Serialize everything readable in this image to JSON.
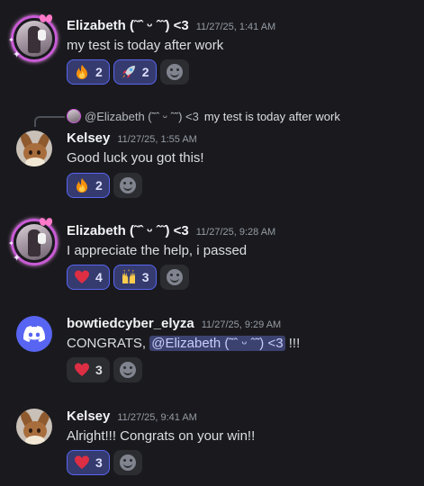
{
  "messages": [
    {
      "author": "Elizabeth (˜ˆ ᵕ ˆ˜) <3",
      "timestamp": "11/27/25, 1:41 AM",
      "text": "my test is today after work",
      "avatar": "decorated-profile-photo",
      "reactions": [
        {
          "emoji": "fire",
          "count": "2",
          "me": true
        },
        {
          "emoji": "rocket",
          "count": "2",
          "me": true
        }
      ]
    },
    {
      "reply_to": {
        "author": "@Elizabeth (˜ˆ ᵕ ˆ˜) <3",
        "text": "my test is today after work"
      },
      "author": "Kelsey",
      "timestamp": "11/27/25, 1:55 AM",
      "text": "Good luck you got this!",
      "avatar": "eevee",
      "reactions": [
        {
          "emoji": "fire",
          "count": "2",
          "me": true
        }
      ]
    },
    {
      "author": "Elizabeth (˜ˆ ᵕ ˆ˜) <3",
      "timestamp": "11/27/25, 9:28 AM",
      "text": "I appreciate the help, i passed",
      "avatar": "decorated-profile-photo",
      "reactions": [
        {
          "emoji": "red-heart",
          "count": "4",
          "me": true
        },
        {
          "emoji": "raising-hands",
          "count": "3",
          "me": true
        }
      ]
    },
    {
      "author": "bowtiedcyber_elyza",
      "timestamp": "11/27/25, 9:29 AM",
      "text_before": "CONGRATS, ",
      "mention": "@Elizabeth (˜ˆ ᵕ ˆ˜) <3",
      "text_after": " !!!",
      "avatar": "discord-default",
      "reactions": [
        {
          "emoji": "red-heart",
          "count": "3",
          "me": false
        }
      ]
    },
    {
      "author": "Kelsey",
      "timestamp": "11/27/25, 9:41 AM",
      "text": "Alright!!! Congrats on your win!!",
      "avatar": "eevee",
      "reactions": [
        {
          "emoji": "red-heart",
          "count": "3",
          "me": true
        }
      ]
    }
  ],
  "colors": {
    "background": "#1a1a1e",
    "reaction_selected_bg": "#353b6e",
    "reaction_selected_border": "#5865f2",
    "mention_bg": "#3c4270",
    "discord_blurple": "#5865f2"
  }
}
